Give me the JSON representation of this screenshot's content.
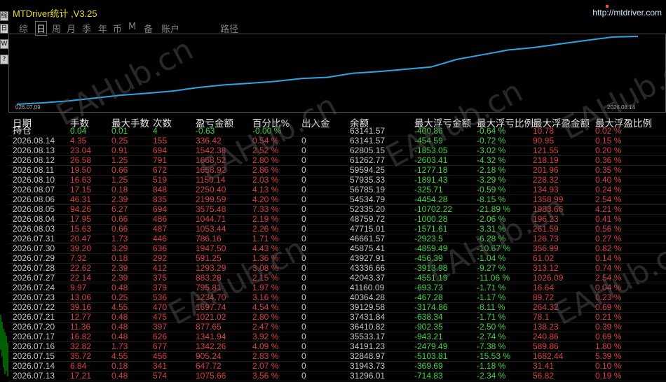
{
  "app": {
    "title": "MTDriver统计 ,V3.25",
    "url": "http://mtdriver.com"
  },
  "side_icons": [
    "综",
    "日",
    "W",
    "?"
  ],
  "nav": [
    {
      "label": "综",
      "active": false
    },
    {
      "label": "日",
      "active": true
    },
    {
      "label": "周",
      "active": false
    },
    {
      "label": "月",
      "active": false
    },
    {
      "label": "季",
      "active": false
    },
    {
      "label": "年",
      "active": false
    },
    {
      "label": "币",
      "active": false
    },
    {
      "label": "M",
      "active": false
    },
    {
      "label": "备",
      "active": false
    },
    {
      "label": "账户",
      "active": false
    },
    {
      "label": "路径",
      "active": false
    }
  ],
  "chart_data": {
    "type": "line",
    "x_start_label": "026.07.09",
    "x_end_label": "2026.08.14",
    "series": [
      {
        "values": [
          31296.01,
          31943.73,
          32848.97,
          34191.23,
          35533.17,
          36410.82,
          37431.84,
          39129.58,
          40364.28,
          41160.09,
          42043.37,
          43336.66,
          43927.91,
          45875.41,
          46661.57,
          47715.01,
          48759.72,
          52335.2,
          54534.79,
          56785.19,
          57935.33,
          59594.25,
          61262.77,
          62805.15,
          63141.57
        ]
      }
    ],
    "line_color": "#2aa7e6"
  },
  "table": {
    "headers": [
      "日期",
      "手数",
      "最大手数",
      "次数",
      "盈亏金额",
      "百分比%",
      "出入金",
      "余额",
      "最大浮亏金额",
      "最大浮亏比例",
      "最大浮盈金额",
      "最大浮盈比例"
    ],
    "holding": {
      "date": "持仓",
      "lots": "0.04",
      "max_lots": "0.01",
      "count": "4",
      "pnl": "-0.63",
      "pct": "-0.00 %",
      "flow": "",
      "balance": "63141.57",
      "max_float_loss": "-400.86",
      "max_float_loss_pct": "-0.64 %",
      "max_float_profit": "10.78",
      "max_float_profit_pct": "0.02 %"
    },
    "rows": [
      {
        "date": "2026.08.14",
        "lots": "4.35",
        "max_lots": "0.25",
        "count": "155",
        "pnl": "336.42",
        "pct": "0.54 %",
        "flow": "0",
        "balance": "63141.57",
        "max_float_loss": "-454.59",
        "max_float_loss_pct": "-0.72 %",
        "max_float_profit": "90.95",
        "max_float_profit_pct": "0.15 %"
      },
      {
        "date": "2026.08.13",
        "lots": "23.04",
        "max_lots": "0.91",
        "count": "694",
        "pnl": "1542.38",
        "pct": "2.52 %",
        "flow": "0",
        "balance": "62805.15",
        "max_float_loss": "-1853.05",
        "max_float_loss_pct": "-3.02 %",
        "max_float_profit": "121.55",
        "max_float_profit_pct": "0.20 %"
      },
      {
        "date": "2026.08.12",
        "lots": "26.58",
        "max_lots": "1.25",
        "count": "791",
        "pnl": "1668.52",
        "pct": "2.80 %",
        "flow": "0",
        "balance": "61262.77",
        "max_float_loss": "-2603.41",
        "max_float_loss_pct": "-4.32 %",
        "max_float_profit": "218.19",
        "max_float_profit_pct": "0.36 %"
      },
      {
        "date": "2026.08.11",
        "lots": "19.50",
        "max_lots": "0.66",
        "count": "672",
        "pnl": "1658.92",
        "pct": "2.86 %",
        "flow": "0",
        "balance": "59594.25",
        "max_float_loss": "-1277.18",
        "max_float_loss_pct": "-2.18 %",
        "max_float_profit": "201.96",
        "max_float_profit_pct": "0.35 %"
      },
      {
        "date": "2026.08.10",
        "lots": "16.63",
        "max_lots": "1.25",
        "count": "519",
        "pnl": "1150.14",
        "pct": "2.03 %",
        "flow": "0",
        "balance": "57935.33",
        "max_float_loss": "-1891.43",
        "max_float_loss_pct": "-3.29 %",
        "max_float_profit": "228.32",
        "max_float_profit_pct": "0.40 %"
      },
      {
        "date": "2026.08.07",
        "lots": "17.15",
        "max_lots": "0.18",
        "count": "848",
        "pnl": "2250.40",
        "pct": "4.13 %",
        "flow": "0",
        "balance": "56785.19",
        "max_float_loss": "-325.71",
        "max_float_loss_pct": "-0.59 %",
        "max_float_profit": "134.93",
        "max_float_profit_pct": "0.24 %"
      },
      {
        "date": "2026.08.06",
        "lots": "46.31",
        "max_lots": "2.39",
        "count": "835",
        "pnl": "2199.59",
        "pct": "4.20 %",
        "flow": "0",
        "balance": "54534.79",
        "max_float_loss": "-4454.28",
        "max_float_loss_pct": "-8.15 %",
        "max_float_profit": "1358.99",
        "max_float_profit_pct": "2.54 %"
      },
      {
        "date": "2026.08.05",
        "lots": "94.26",
        "max_lots": "6.27",
        "count": "694",
        "pnl": "3575.48",
        "pct": "7.33 %",
        "flow": "0",
        "balance": "52335.20",
        "max_float_loss": "-10702.22",
        "max_float_loss_pct": "-21.89 %",
        "max_float_profit": "1983.66",
        "max_float_profit_pct": "4.21 %"
      },
      {
        "date": "2026.08.04",
        "lots": "17.95",
        "max_lots": "0.66",
        "count": "486",
        "pnl": "1044.71",
        "pct": "2.19 %",
        "flow": "0",
        "balance": "48759.72",
        "max_float_loss": "-1000.28",
        "max_float_loss_pct": "-2.06 %",
        "max_float_profit": "196.23",
        "max_float_profit_pct": "0.41 %"
      },
      {
        "date": "2026.08.03",
        "lots": "15.63",
        "max_lots": "0.66",
        "count": "487",
        "pnl": "1053.44",
        "pct": "2.26 %",
        "flow": "0",
        "balance": "47715.01",
        "max_float_loss": "-1571.61",
        "max_float_loss_pct": "-3.31 %",
        "max_float_profit": "261.59",
        "max_float_profit_pct": "0.56 %"
      },
      {
        "date": "2026.07.31",
        "lots": "20.47",
        "max_lots": "1.73",
        "count": "446",
        "pnl": "786.16",
        "pct": "1.71 %",
        "flow": "0",
        "balance": "46661.57",
        "max_float_loss": "-2923.5",
        "max_float_loss_pct": "-6.28 %",
        "max_float_profit": "126.73",
        "max_float_profit_pct": "0.27 %"
      },
      {
        "date": "2026.07.30",
        "lots": "39.20",
        "max_lots": "3.29",
        "count": "636",
        "pnl": "1947.50",
        "pct": "4.43 %",
        "flow": "0",
        "balance": "45875.41",
        "max_float_loss": "-4859.49",
        "max_float_loss_pct": "-10.67 %",
        "max_float_profit": "356.99",
        "max_float_profit_pct": "0.82 %"
      },
      {
        "date": "2026.07.29",
        "lots": "7.32",
        "max_lots": "0.18",
        "count": "292",
        "pnl": "591.25",
        "pct": "1.36 %",
        "flow": "0",
        "balance": "43927.91",
        "max_float_loss": "-456.39",
        "max_float_loss_pct": "-1.04 %",
        "max_float_profit": "61.02",
        "max_float_profit_pct": "0.14 %"
      },
      {
        "date": "2026.07.28",
        "lots": "22.62",
        "max_lots": "2.39",
        "count": "412",
        "pnl": "1293.29",
        "pct": "3.08 %",
        "flow": "0",
        "balance": "43336.66",
        "max_float_loss": "-3913.98",
        "max_float_loss_pct": "-9.27 %",
        "max_float_profit": "313.12",
        "max_float_profit_pct": "0.74 %"
      },
      {
        "date": "2026.07.27",
        "lots": "22.14",
        "max_lots": "2.39",
        "count": "375",
        "pnl": "883.28",
        "pct": "2.15 %",
        "flow": "0",
        "balance": "42043.37",
        "max_float_loss": "-4551.19",
        "max_float_loss_pct": "-11.06 %",
        "max_float_profit": "1026.09",
        "max_float_profit_pct": "2.54 %"
      },
      {
        "date": "2026.07.24",
        "lots": "9.97",
        "max_lots": "0.48",
        "count": "379",
        "pnl": "795.81",
        "pct": "1.97 %",
        "flow": "0",
        "balance": "41160.09",
        "max_float_loss": "-693.73",
        "max_float_loss_pct": "-1.71 %",
        "max_float_profit": "16.64",
        "max_float_profit_pct": "0.04 %"
      },
      {
        "date": "2026.07.23",
        "lots": "13.06",
        "max_lots": "0.25",
        "count": "536",
        "pnl": "1234.70",
        "pct": "3.16 %",
        "flow": "0",
        "balance": "40364.28",
        "max_float_loss": "-467.28",
        "max_float_loss_pct": "-1.17 %",
        "max_float_profit": "89.72",
        "max_float_profit_pct": "0.23 %"
      },
      {
        "date": "2026.07.22",
        "lots": "39.16",
        "max_lots": "4.55",
        "count": "470",
        "pnl": "1697.74",
        "pct": "4.54 %",
        "flow": "0",
        "balance": "39129.58",
        "max_float_loss": "-3174.86",
        "max_float_loss_pct": "-8.11 %",
        "max_float_profit": "264.32",
        "max_float_profit_pct": "0.69 %"
      },
      {
        "date": "2026.07.21",
        "lots": "12.77",
        "max_lots": "0.48",
        "count": "475",
        "pnl": "1021.02",
        "pct": "2.80 %",
        "flow": "0",
        "balance": "37431.84",
        "max_float_loss": "-638.34",
        "max_float_loss_pct": "-1.71 %",
        "max_float_profit": "78.1",
        "max_float_profit_pct": "0.21 %"
      },
      {
        "date": "2026.07.20",
        "lots": "11.36",
        "max_lots": "0.48",
        "count": "397",
        "pnl": "877.65",
        "pct": "2.47 %",
        "flow": "0",
        "balance": "36410.82",
        "max_float_loss": "-902.35",
        "max_float_loss_pct": "-2.50 %",
        "max_float_profit": "138.23",
        "max_float_profit_pct": "0.39 %"
      },
      {
        "date": "2026.07.17",
        "lots": "16.82",
        "max_lots": "0.48",
        "count": "626",
        "pnl": "1341.94",
        "pct": "3.92 %",
        "flow": "0",
        "balance": "35533.17",
        "max_float_loss": "-943.21",
        "max_float_loss_pct": "-2.74 %",
        "max_float_profit": "240.86",
        "max_float_profit_pct": "0.69 %"
      },
      {
        "date": "2026.07.16",
        "lots": "32.82",
        "max_lots": "1.73",
        "count": "677",
        "pnl": "1342.26",
        "pct": "4.09 %",
        "flow": "0",
        "balance": "34191.23",
        "max_float_loss": "-2479.49",
        "max_float_loss_pct": "-7.38 %",
        "max_float_profit": "589.86",
        "max_float_profit_pct": "1.80 %"
      },
      {
        "date": "2026.07.15",
        "lots": "35.72",
        "max_lots": "4.55",
        "count": "456",
        "pnl": "905.24",
        "pct": "2.83 %",
        "flow": "0",
        "balance": "32848.97",
        "max_float_loss": "-5103.81",
        "max_float_loss_pct": "-15.53 %",
        "max_float_profit": "1682.44",
        "max_float_profit_pct": "5.39 %"
      },
      {
        "date": "2026.07.14",
        "lots": "6.84",
        "max_lots": "0.18",
        "count": "341",
        "pnl": "647.72",
        "pct": "2.07 %",
        "flow": "0",
        "balance": "31943.73",
        "max_float_loss": "-369.69",
        "max_float_loss_pct": "-1.18 %",
        "max_float_profit": "31.41",
        "max_float_profit_pct": "0.10 %"
      },
      {
        "date": "2026.07.13",
        "lots": "17.21",
        "max_lots": "0.48",
        "count": "574",
        "pnl": "1075.66",
        "pct": "3.56 %",
        "flow": "0",
        "balance": "31296.01",
        "max_float_loss": "-714.83",
        "max_float_loss_pct": "-2.34 %",
        "max_float_profit": "56.82",
        "max_float_profit_pct": "0.19 %"
      }
    ]
  },
  "watermark": "EAHub.cn",
  "colors": {
    "title": "#f0e000",
    "header": "#e8e8e8",
    "date": "#c8c8c8",
    "profit_red": "#e03c3c",
    "loss_green": "#33dd33",
    "neutral": "#c8c8c8",
    "holding_green": "#33dd33",
    "holding_count_green": "#33dd33"
  }
}
